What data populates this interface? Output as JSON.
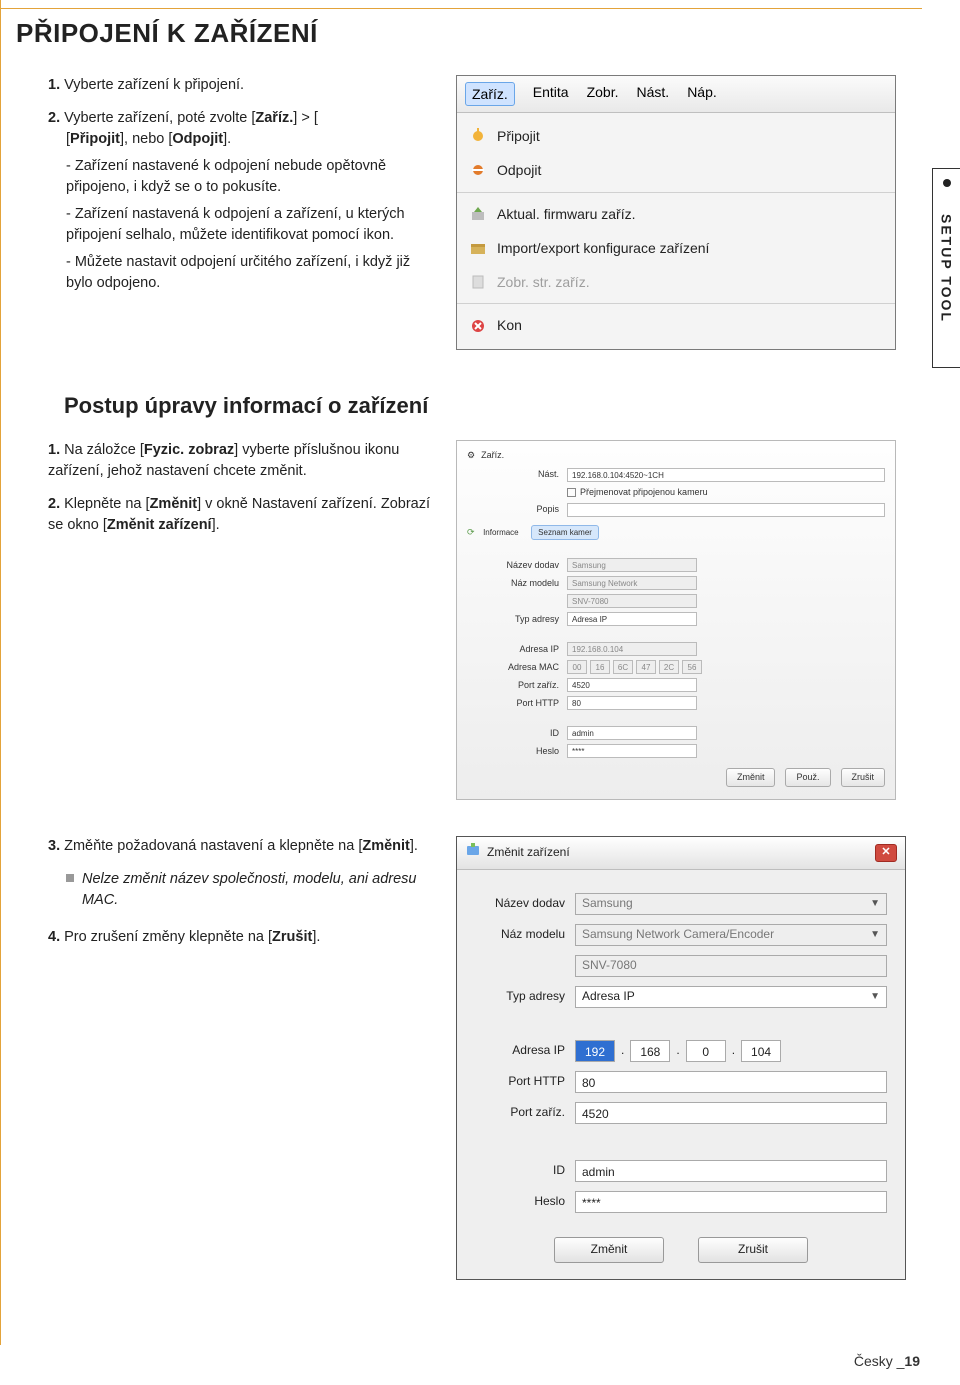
{
  "title": "PŘIPOJENÍ K ZAŘÍZENÍ",
  "sideTab": "SETUP TOOL",
  "stepsA": {
    "s1": "Vyberte zařízení k připojení.",
    "s2a": "Vyberte zařízení, poté zvolte [",
    "s2b": "Zaříz.",
    "s2c": "] > [",
    "s2d": "Připojit",
    "s2e": "], nebo [",
    "s2f": "Odpojit",
    "s2g": "].",
    "sub1": "- Zařízení nastavené k odpojení nebude opětovně připojeno, i když se o to pokusíte.",
    "sub2": "- Zařízení nastavená k odpojení a zařízení, u kterých připojení selhalo, můžete identifikovat pomocí ikon.",
    "sub3": "- Můžete nastavit odpojení určitého zařízení, i když již bylo odpojeno."
  },
  "menubar": {
    "items": [
      "Zaříz.",
      "Entita",
      "Zobr.",
      "Nást.",
      "Náp."
    ]
  },
  "dropdown": {
    "connect": "Připojit",
    "disconnect": "Odpojit",
    "firmware": "Aktual. firmwaru zaříz.",
    "importexport": "Import/export konfigurace zařízení",
    "showpage": "Zobr. str. zaříz.",
    "end": "Kon"
  },
  "section2": "Postup úpravy informací o zařízení",
  "stepsB": {
    "s1a": "Na záložce [",
    "s1b": "Fyzic. zobraz",
    "s1c": "] vyberte příslušnou ikonu zařízení, jehož nastavení chcete změnit.",
    "s2a": "Klepněte na [",
    "s2b": "Změnit",
    "s2c": "] v okně Nastavení zařízení. Zobrazí se okno [",
    "s2d": "Změnit zařízení",
    "s2e": "]."
  },
  "settings": {
    "tabDevice": "Zaříz.",
    "nast": "Nást.",
    "nastVal": "192.168.0.104:4520~1CH",
    "renameChk": "Přejmenovat připojenou kameru",
    "popis": "Popis",
    "tabInfo": "Informace",
    "tabCamList": "Seznam kamer",
    "vendorLbl": "Název dodav",
    "vendorVal": "Samsung",
    "modelLbl": "Náz modelu",
    "modelVal": "Samsung Network Camera/Encoder",
    "modelCode": "SNV-7080",
    "addrTypeLbl": "Typ adresy",
    "addrTypeVal": "Adresa IP",
    "ipLbl": "Adresa IP",
    "ipVal": "192.168.0.104",
    "macLbl": "Adresa MAC",
    "mac": [
      "00",
      "16",
      "6C",
      "47",
      "2C",
      "56"
    ],
    "portDevLbl": "Port zaříz.",
    "portDevVal": "4520",
    "portHttpLbl": "Port HTTP",
    "portHttpVal": "80",
    "idLbl": "ID",
    "idVal": "admin",
    "pwLbl": "Heslo",
    "pwVal": "****",
    "btnChange": "Změnit",
    "btnApply": "Použ.",
    "btnCancel": "Zrušit"
  },
  "stepsC": {
    "s3a": "Změňte požadovaná nastavení a klepněte na [",
    "s3b": "Změnit",
    "s3c": "].",
    "note": "Nelze změnit název společnosti, modelu, ani adresu MAC.",
    "s4a": "Pro zrušení změny klepněte na [",
    "s4b": "Zrušit",
    "s4c": "]."
  },
  "dialog": {
    "title": "Změnit zařízení",
    "vendorLbl": "Název dodav",
    "vendorVal": "Samsung",
    "modelLbl": "Náz modelu",
    "modelVal": "Samsung Network Camera/Encoder",
    "modelCode": "SNV-7080",
    "addrTypeLbl": "Typ adresy",
    "addrTypeVal": "Adresa IP",
    "ipLbl": "Adresa IP",
    "ip": [
      "192",
      "168",
      "0",
      "104"
    ],
    "portHttpLbl": "Port HTTP",
    "portHttpVal": "80",
    "portDevLbl": "Port zaříz.",
    "portDevVal": "4520",
    "idLbl": "ID",
    "idVal": "admin",
    "pwLbl": "Heslo",
    "pwVal": "****",
    "btnChange": "Změnit",
    "btnCancel": "Zrušit"
  },
  "footer": {
    "lang": "Česky _",
    "page": "19"
  }
}
